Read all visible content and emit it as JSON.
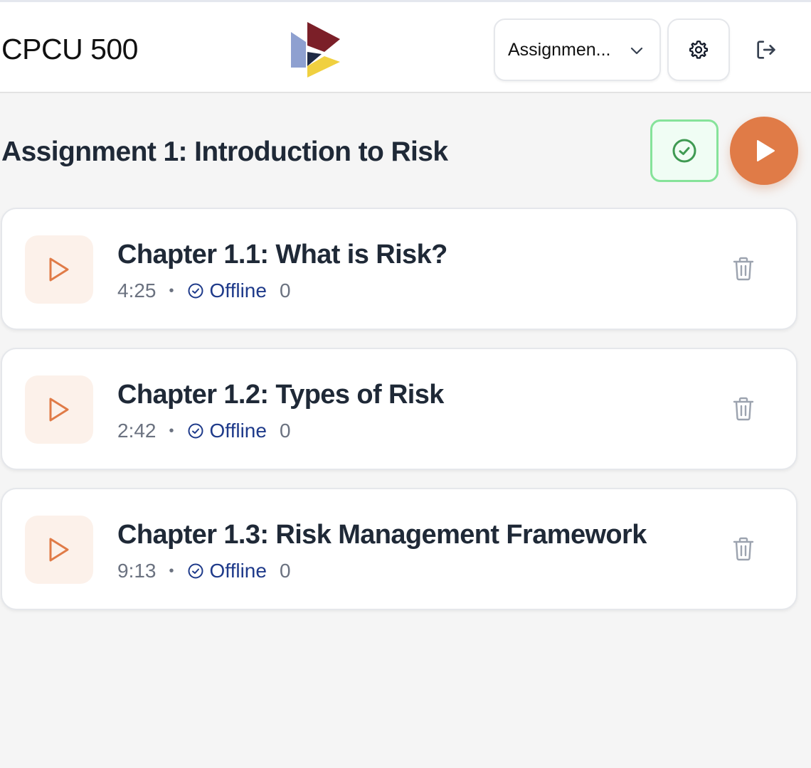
{
  "header": {
    "course_title": "CPCU 500",
    "assignment_select_value": "Assignmen..."
  },
  "assignment": {
    "title": "Assignment 1: Introduction to Risk"
  },
  "chapters": [
    {
      "title": "Chapter 1.1: What is Risk?",
      "duration": "4:25",
      "status": "Offline",
      "count": "0"
    },
    {
      "title": "Chapter 1.2: Types of Risk",
      "duration": "2:42",
      "status": "Offline",
      "count": "0"
    },
    {
      "title": "Chapter 1.3: Risk Management Framework",
      "duration": "9:13",
      "status": "Offline",
      "count": "0"
    }
  ],
  "meta_separator": "•",
  "icons": {
    "logo": "logo-icon",
    "assignment_select": "chevron-down-icon",
    "settings": "gear-icon",
    "logout": "logout-icon",
    "complete": "check-circle-icon",
    "play_all": "play-icon",
    "chapter_play": "play-outline-icon",
    "offline": "check-circle-icon",
    "delete": "trash-icon"
  },
  "colors": {
    "accent": "#e07b47",
    "success_border": "#86e39a",
    "success_bg": "#f0fdf4",
    "offline_text": "#1e3a8a",
    "logo_maroon": "#7b1f28",
    "logo_navy": "#1f2a44",
    "logo_yellow": "#f0d040",
    "logo_periwinkle": "#8ea0d0"
  }
}
